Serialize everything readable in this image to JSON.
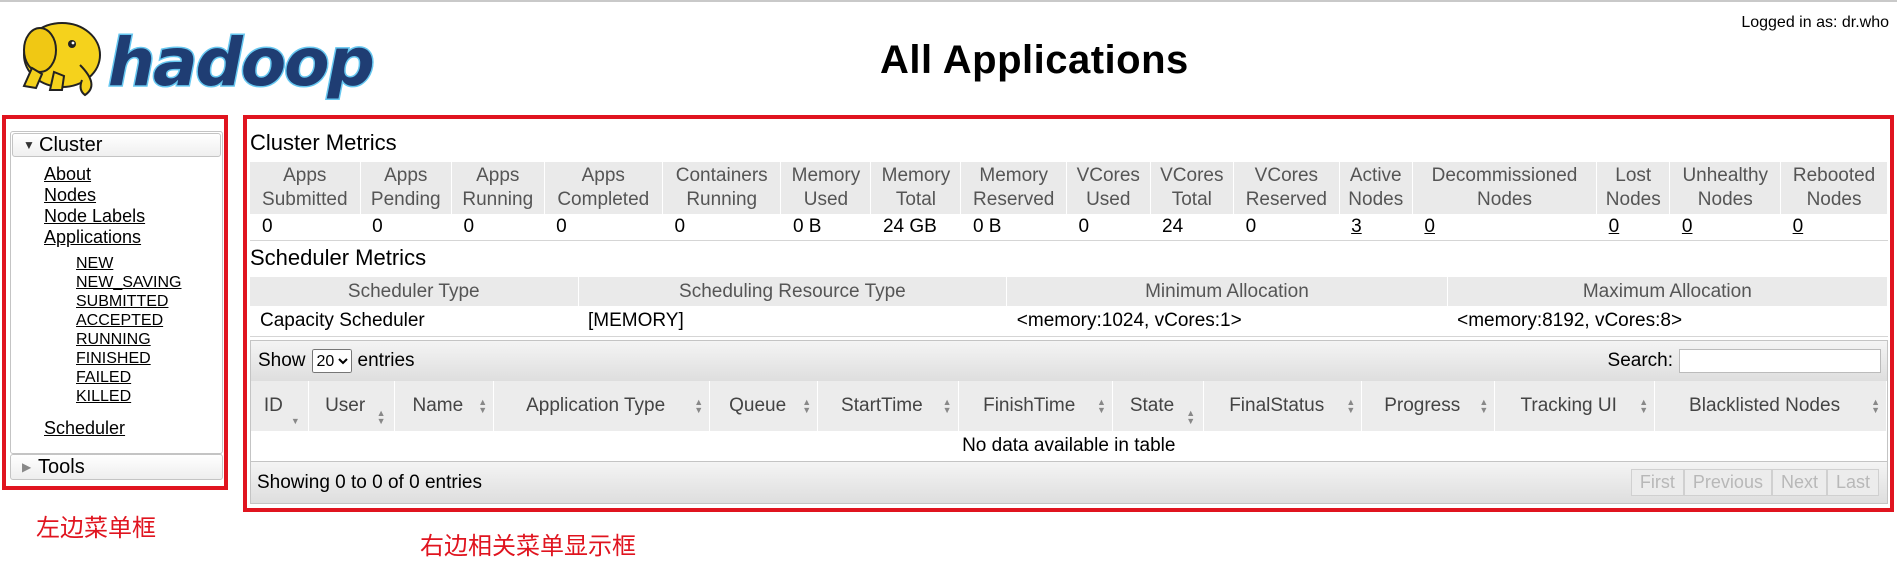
{
  "header": {
    "title": "All Applications",
    "login_text": "Logged in as: dr.who",
    "logo_text": "hadoop"
  },
  "sidebar": {
    "cluster_label": "Cluster",
    "links": [
      "About",
      "Nodes",
      "Node Labels",
      "Applications"
    ],
    "app_states": [
      "NEW",
      "NEW_SAVING",
      "SUBMITTED",
      "ACCEPTED",
      "RUNNING",
      "FINISHED",
      "FAILED",
      "KILLED"
    ],
    "scheduler_link": "Scheduler",
    "tools_label": "Tools"
  },
  "cluster_metrics": {
    "title": "Cluster Metrics",
    "headers": [
      [
        "Apps",
        "Submitted"
      ],
      [
        "Apps",
        "Pending"
      ],
      [
        "Apps",
        "Running"
      ],
      [
        "Apps",
        "Completed"
      ],
      [
        "Containers",
        "Running"
      ],
      [
        "Memory",
        "Used"
      ],
      [
        "Memory",
        "Total"
      ],
      [
        "Memory",
        "Reserved"
      ],
      [
        "VCores",
        "Used"
      ],
      [
        "VCores",
        "Total"
      ],
      [
        "VCores",
        "Reserved"
      ],
      [
        "Active",
        "Nodes"
      ],
      [
        "Decommissioned",
        "Nodes"
      ],
      [
        "Lost",
        "Nodes"
      ],
      [
        "Unhealthy",
        "Nodes"
      ],
      [
        "Rebooted",
        "Nodes"
      ]
    ],
    "values": [
      "0",
      "0",
      "0",
      "0",
      "0",
      "0 B",
      "24 GB",
      "0 B",
      "0",
      "24",
      "0",
      "3",
      "0",
      "0",
      "0",
      "0"
    ],
    "linked": [
      false,
      false,
      false,
      false,
      false,
      false,
      false,
      false,
      false,
      false,
      false,
      true,
      true,
      true,
      true,
      true
    ]
  },
  "scheduler_metrics": {
    "title": "Scheduler Metrics",
    "headers": [
      "Scheduler Type",
      "Scheduling Resource Type",
      "Minimum Allocation",
      "Maximum Allocation"
    ],
    "values": [
      "Capacity Scheduler",
      "[MEMORY]",
      "<memory:1024, vCores:1>",
      "<memory:8192, vCores:8>"
    ]
  },
  "apps_table": {
    "show_label": "Show",
    "entries_label": "entries",
    "page_size": "20",
    "search_label": "Search:",
    "columns": [
      "ID",
      "User",
      "Name",
      "Application Type",
      "Queue",
      "StartTime",
      "FinishTime",
      "State",
      "FinalStatus",
      "Progress",
      "Tracking UI",
      "Blacklisted Nodes"
    ],
    "empty_text": "No data available in table",
    "info_text": "Showing 0 to 0 of 0 entries",
    "pager": [
      "First",
      "Previous",
      "Next",
      "Last"
    ]
  },
  "annotations": {
    "left": "左边菜单框",
    "right": "右边相关菜单显示框"
  }
}
